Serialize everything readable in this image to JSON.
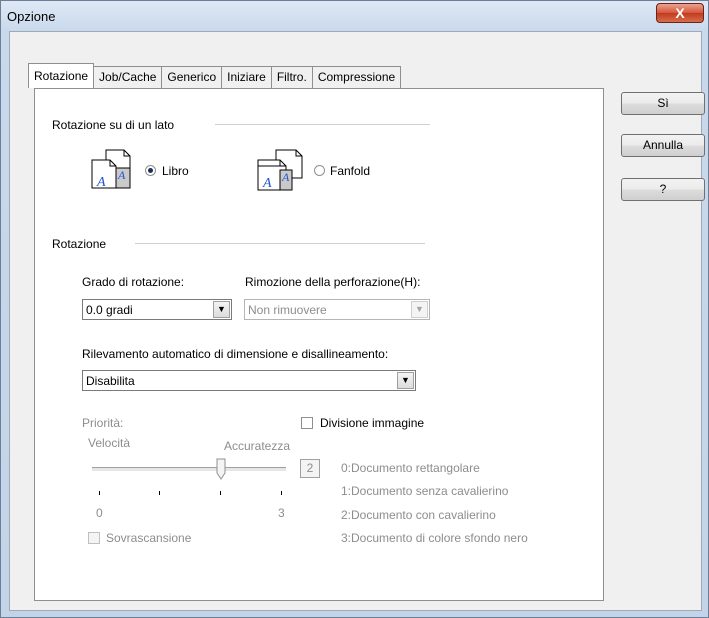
{
  "window": {
    "title": "Opzione",
    "close_label": "X"
  },
  "tabs": [
    {
      "label": "Rotazione"
    },
    {
      "label": "Job/Cache"
    },
    {
      "label": "Generico"
    },
    {
      "label": "Iniziare"
    },
    {
      "label": "Filtro."
    },
    {
      "label": "Compressione"
    }
  ],
  "buttons": {
    "yes": "Sì",
    "cancel": "Annulla",
    "help": "?"
  },
  "rotation_side": {
    "group_label": "Rotazione su di un lato",
    "options": [
      {
        "label": "Libro",
        "checked": true
      },
      {
        "label": "Fanfold",
        "checked": false
      }
    ]
  },
  "rotation": {
    "group_label": "Rotazione",
    "degree_label": "Grado di rotazione:",
    "degree_value": "0.0 gradi",
    "punch_label": "Rimozione della perforazione(H):",
    "punch_value": "Non rimuovere",
    "auto_label": "Rilevamento  automatico di dimensione e disallineamento:",
    "auto_value": "Disabilita"
  },
  "priority": {
    "label": "Priorità:",
    "speed_label": "Velocità",
    "accuracy_label": "Accuratezza",
    "min_label": "0",
    "max_label": "3",
    "value": "2",
    "level": 2
  },
  "split_image": {
    "label": "Divisione immagine",
    "checked": false
  },
  "overscan": {
    "label": "Sovrascansione",
    "checked": false
  },
  "doc_types": [
    "0:Documento rettangolare",
    "1:Documento senza cavalierino",
    "2:Documento con cavalierino",
    "3:Documento di colore sfondo nero"
  ],
  "colors": {
    "accent_close": "#c13a1e",
    "selected_radio": "#1c2f5a",
    "disabled_text": "#8d8d8d"
  }
}
